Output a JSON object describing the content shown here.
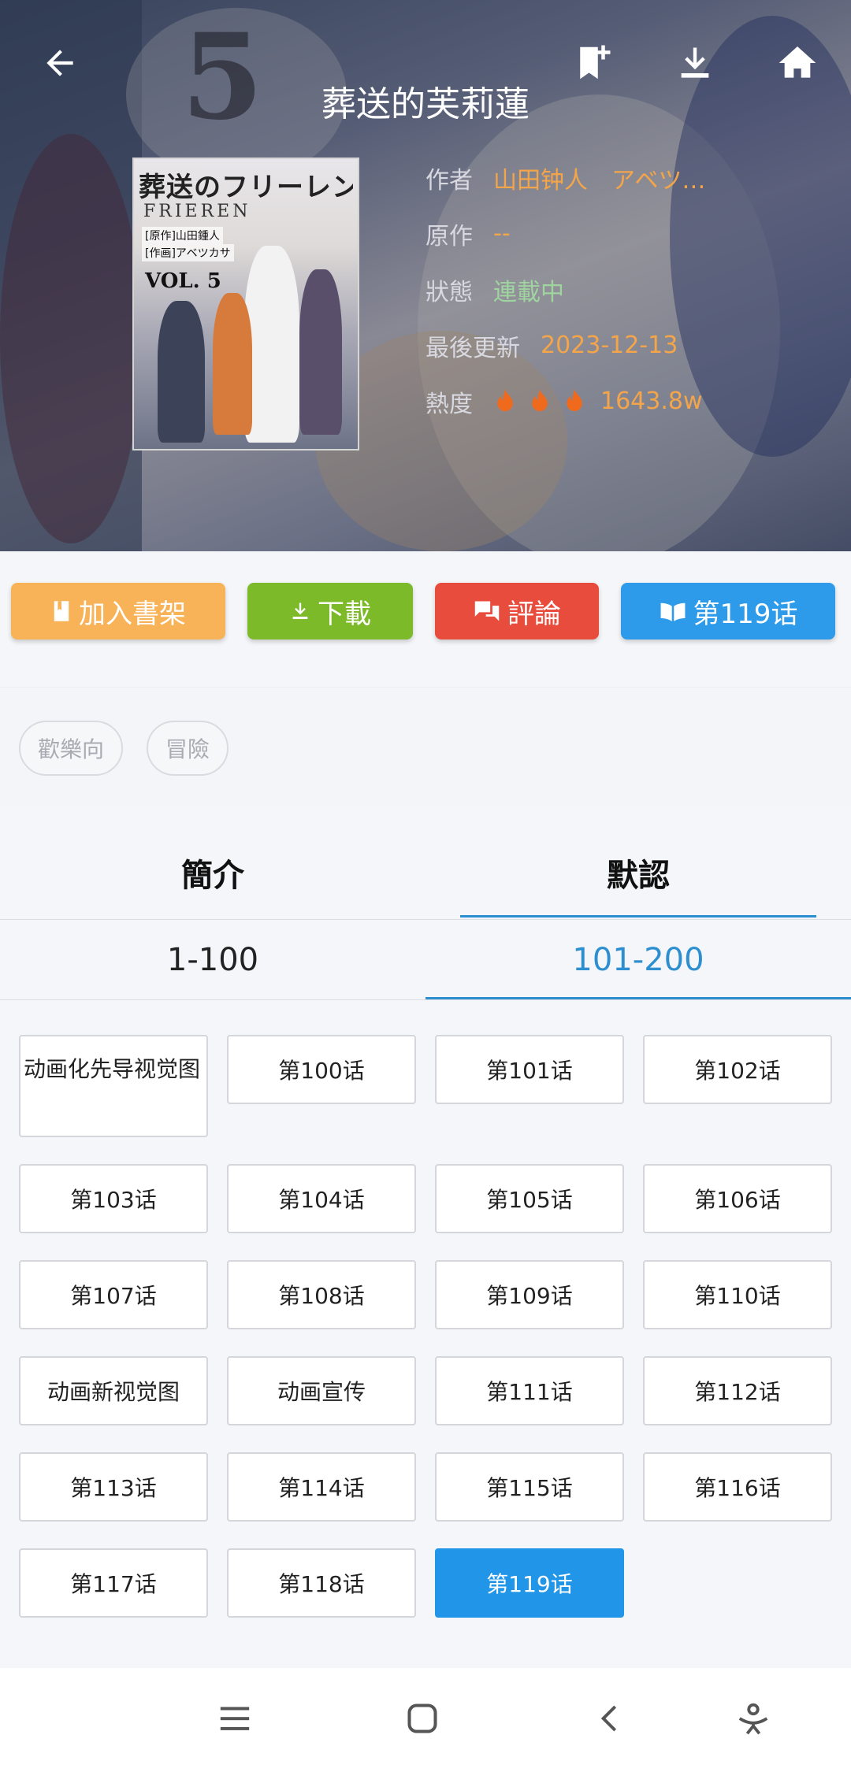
{
  "header": {
    "title": "葬送的芙莉蓮",
    "cover": {
      "title_text": "葬送のフリーレン",
      "subtitle_text": "FRIEREN",
      "credit_1": "[原作]山田鍾人",
      "credit_2": "[作画]アベツカサ",
      "volume_text": "VOL. 5"
    },
    "info": {
      "author_label": "作者",
      "author_value": "山田钟人　アベツ…",
      "original_label": "原作",
      "original_value": "--",
      "status_label": "狀態",
      "status_value": "連載中",
      "updated_label": "最後更新",
      "updated_value": "2023-12-13",
      "heat_label": "熱度",
      "heat_value": "1643.8w"
    },
    "icons": [
      "back-arrow-icon",
      "bookmark-add-icon",
      "download-icon",
      "home-icon"
    ]
  },
  "actions": {
    "shelf": "加入書架",
    "download": "下載",
    "comment": "評論",
    "read": "第119话"
  },
  "tags": [
    "歡樂向",
    "冒險"
  ],
  "tabs": {
    "intro": "簡介",
    "default": "默認"
  },
  "ranges": {
    "first": "1-100",
    "second": "101-200"
  },
  "chapters": [
    "动画化先导视觉图",
    "第100话",
    "第101话",
    "第102话",
    "第103话",
    "第104话",
    "第105话",
    "第106话",
    "第107话",
    "第108话",
    "第109话",
    "第110话",
    "动画新视觉图",
    "动画宣传",
    "第111话",
    "第112话",
    "第113话",
    "第114话",
    "第115话",
    "第116话",
    "第117话",
    "第118话",
    "第119话"
  ],
  "colors": {
    "shelf": "#f8b358",
    "download": "#7dba2a",
    "comment": "#e74c3c",
    "read": "#2d9bea",
    "accent": "#2d8fd0",
    "current_chapter": "#2196e8",
    "info_value": "#f4a54a",
    "heat_flame": "#f06a1d"
  },
  "navbar": [
    "menu-icon",
    "home-square-icon",
    "back-icon",
    "accessibility-icon"
  ]
}
